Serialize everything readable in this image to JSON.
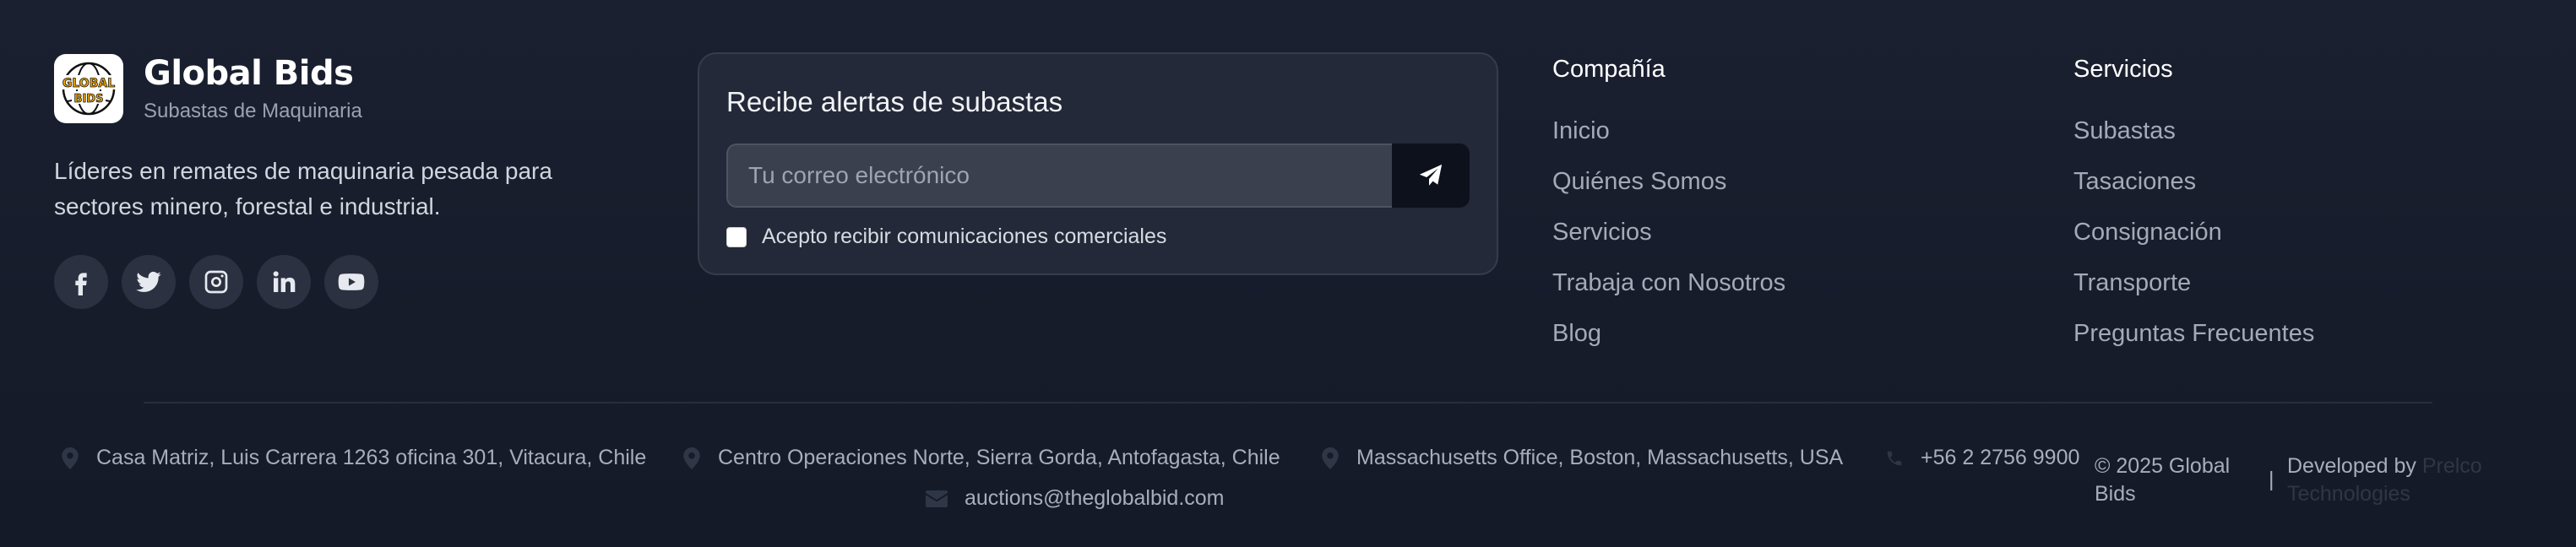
{
  "brand": {
    "name": "Global Bids",
    "tagline": "Subastas de Maquinaria",
    "logo_text_top": "GLOBAL",
    "logo_text_bottom": "BIDS",
    "description": "Líderes en remates de maquinaria pesada para sectores minero, forestal e industrial.",
    "socials": [
      {
        "icon": "facebook-icon"
      },
      {
        "icon": "twitter-icon"
      },
      {
        "icon": "instagram-icon"
      },
      {
        "icon": "linkedin-icon"
      },
      {
        "icon": "youtube-icon"
      }
    ]
  },
  "newsletter": {
    "title": "Recibe alertas de subastas",
    "email_placeholder": "Tu correo electrónico",
    "submit_icon": "paper-plane-icon",
    "consent_label": "Acepto recibir comunicaciones comerciales",
    "consent_checked": false
  },
  "company": {
    "title": "Compañía",
    "links": [
      "Inicio",
      "Quiénes Somos",
      "Servicios",
      "Trabaja con Nosotros",
      "Blog"
    ]
  },
  "services": {
    "title": "Servicios",
    "links": [
      "Subastas",
      "Tasaciones",
      "Consignación",
      "Transporte",
      "Preguntas Frecuentes"
    ]
  },
  "contact": {
    "address_main": "Casa Matriz, Luis Carrera 1263 oficina 301, Vitacura, Chile",
    "address_north": "Centro Operaciones Norte, Sierra Gorda, Antofagasta, Chile",
    "address_usa": "Massachusetts Office, Boston, Massachusetts, USA",
    "phone": "+56 2 2756 9900",
    "email": "auctions@theglobalbid.com"
  },
  "legal": {
    "copyright": "© 2025 Global Bids",
    "separator": "|",
    "developed_by": "Developed by",
    "developer": "Prelco Technologies"
  },
  "colors": {
    "background": "#161c2b",
    "card": "#232938",
    "button": "#0d111c",
    "logo_accent": "#f2a900"
  }
}
